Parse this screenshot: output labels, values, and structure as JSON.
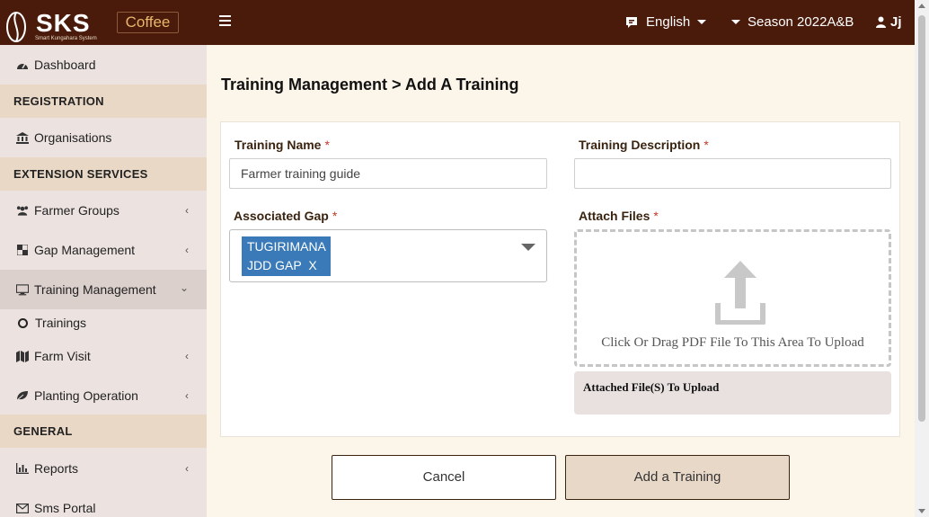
{
  "header": {
    "logo_text": "SKS",
    "logo_subtitle": "Smart Kungahara System",
    "product_badge": "Coffee",
    "language": "English",
    "season": "Season 2022A&B",
    "user": "Jj"
  },
  "sidebar": {
    "dashboard": "Dashboard",
    "registration_header": "REGISTRATION",
    "organisations": "Organisations",
    "extension_header": "EXTENSION SERVICES",
    "farmer_groups": "Farmer Groups",
    "gap_management": "Gap Management",
    "training_management": "Training Management",
    "trainings": "Trainings",
    "farm_visit": "Farm Visit",
    "planting_operation": "Planting Operation",
    "general_header": "GENERAL",
    "reports": "Reports",
    "sms_portal": "Sms Portal"
  },
  "page": {
    "title": "Training Management > Add A Training"
  },
  "form": {
    "training_name_label": "Training Name",
    "training_name_value": "Farmer training guide",
    "training_description_label": "Training Description",
    "training_description_value": "",
    "associated_gap_label": "Associated Gap",
    "associated_gap_tag": "TUGIRIMANA JDD GAP",
    "tag_remove": "X",
    "attach_files_label": "Attach Files",
    "upload_hint": "Click Or Drag PDF File To This Area To Upload",
    "attached_files_title": "Attached File(S) To Upload",
    "required_mark": "*"
  },
  "actions": {
    "cancel": "Cancel",
    "submit": "Add a Training"
  }
}
